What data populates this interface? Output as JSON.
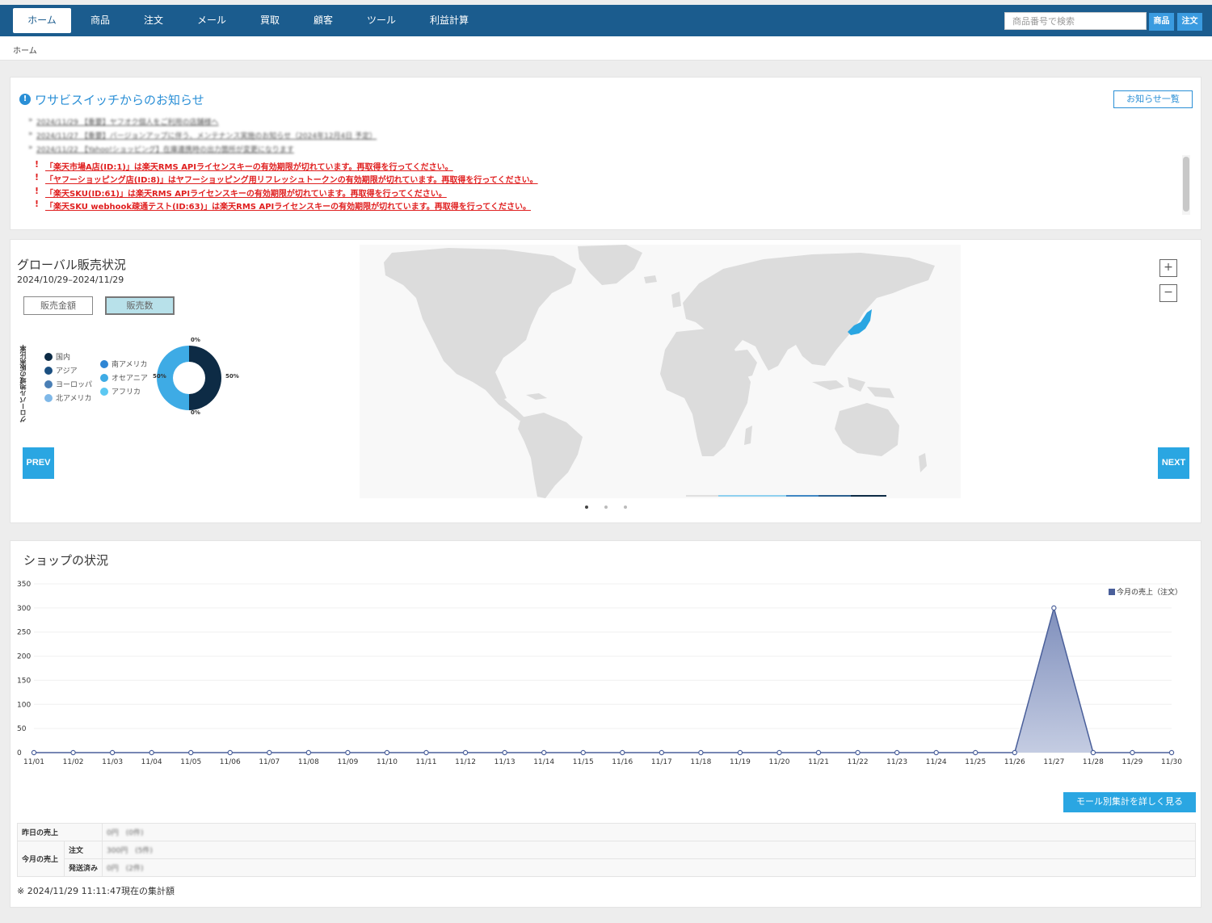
{
  "nav": {
    "items": [
      "ホーム",
      "商品",
      "注文",
      "メール",
      "買取",
      "顧客",
      "ツール",
      "利益計算"
    ],
    "search_placeholder": "商品番号で検索",
    "search_product_btn": "商品",
    "search_order_btn": "注文"
  },
  "breadcrumb": "ホーム",
  "news": {
    "title": "ワサビスイッチからのお知らせ",
    "list_button": "お知らせ一覧",
    "items": [
      "2024/11/29 【重要】ヤフオク個人をご利用の店舗様へ",
      "2024/11/27 【重要】バージョンアップに伴う、メンテナンス実施のお知らせ（2024年12月4日 予定）",
      "2024/11/22 【Yahoo!ショッピング】在庫連携時の出力箇所が変更になります"
    ],
    "alert_mark": "!",
    "alerts": [
      "「楽天市場A店(ID:1)」は楽天RMS APIライセンスキーの有効期限が切れています。再取得を行ってください。",
      "「ヤフーショッピング店(ID:8)」はヤフーショッピング用リフレッシュトークンの有効期限が切れています。再取得を行ってください。",
      "「楽天SKU(ID:61)」は楽天RMS APIライセンスキーの有効期限が切れています。再取得を行ってください。",
      "「楽天SKU webhook疎通テスト(ID:63)」は楽天RMS APIライセンスキーの有効期限が切れています。再取得を行ってください。"
    ]
  },
  "global": {
    "title": "グローバル販売状況",
    "date_range": "2024/10/29–2024/11/29",
    "toggle_amount": "販売金額",
    "toggle_count": "販売数",
    "toggle_selected": "販売数",
    "y_label": "グローバル地域の販売比率",
    "legend": [
      {
        "label": "国内",
        "color": "#0d2b45"
      },
      {
        "label": "アジア",
        "color": "#1b4f80"
      },
      {
        "label": "ヨーロッパ",
        "color": "#4a7fb5"
      },
      {
        "label": "北アメリカ",
        "color": "#7fb8e8"
      },
      {
        "label": "南アメリカ",
        "color": "#2f86d4"
      },
      {
        "label": "オセアニア",
        "color": "#3eabe5"
      },
      {
        "label": "アフリカ",
        "color": "#5cc8f2"
      }
    ],
    "donut": {
      "slices": [
        {
          "label": "国内",
          "percent": 50,
          "color": "#0d2b45"
        },
        {
          "label": "オセアニア",
          "percent": 50,
          "color": "#3eabe5"
        }
      ],
      "label_top": "0%",
      "label_right": "50%",
      "label_left": "50%",
      "label_bottom": "0%"
    },
    "zoom_in": "+",
    "zoom_out": "−",
    "prev": "PREV",
    "next": "NEXT",
    "highlight_country": "Japan",
    "highlight_color": "#2aa6e2",
    "carousel_index": 1,
    "carousel_count": 3
  },
  "shop": {
    "title": "ショップの状況",
    "mall_button": "モール別集計を詳しく見る",
    "table": {
      "yesterday_label": "昨日の売上",
      "yesterday_value": "0円　(0件)",
      "month_label": "今月の売上",
      "order_label": "注文",
      "order_value": "300円　(5件)",
      "shipped_label": "発送済み",
      "shipped_value": "0円　(2件)"
    },
    "footnote": "※ 2024/11/29 11:11:47現在の集計額"
  },
  "chart_data": {
    "type": "area",
    "title": "",
    "xlabel": "",
    "ylabel": "",
    "x": [
      "11/01",
      "11/02",
      "11/03",
      "11/04",
      "11/05",
      "11/06",
      "11/07",
      "11/08",
      "11/09",
      "11/10",
      "11/11",
      "11/12",
      "11/13",
      "11/14",
      "11/15",
      "11/16",
      "11/17",
      "11/18",
      "11/19",
      "11/20",
      "11/21",
      "11/22",
      "11/23",
      "11/24",
      "11/25",
      "11/26",
      "11/27",
      "11/28",
      "11/29",
      "11/30"
    ],
    "yticks": [
      0,
      50,
      100,
      150,
      200,
      250,
      300,
      350
    ],
    "ylim": [
      0,
      350
    ],
    "series": [
      {
        "name": "今月の売上（注文）",
        "color": "#4a5f9a",
        "values": [
          0,
          0,
          0,
          0,
          0,
          0,
          0,
          0,
          0,
          0,
          0,
          0,
          0,
          0,
          0,
          0,
          0,
          0,
          0,
          0,
          0,
          0,
          0,
          0,
          0,
          0,
          300,
          0,
          0,
          0
        ]
      }
    ],
    "legend_position": "top-right",
    "grid": true
  }
}
